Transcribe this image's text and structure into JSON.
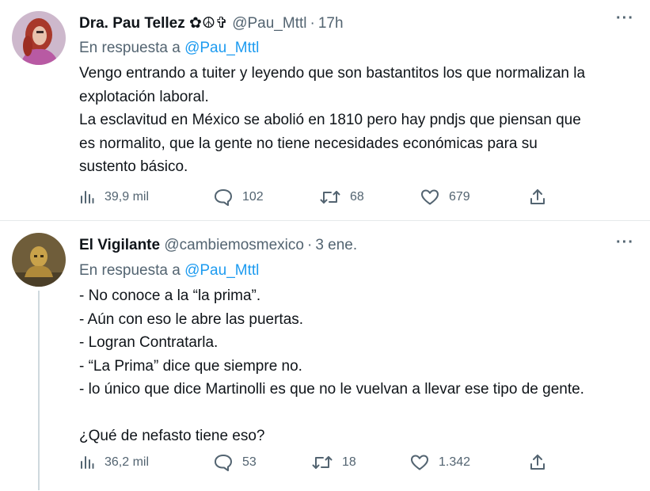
{
  "tweets": [
    {
      "name": "Dra. Pau Tellez",
      "name_symbols": "✿☮✞",
      "handle": "@Pau_Mttl",
      "time": "17h",
      "reply_prefix": "En respuesta a",
      "reply_to": "@Pau_Mttl",
      "lines": [
        "Vengo entrando a tuiter y leyendo que son bastantitos los que normalizan la",
        "explotación laboral.",
        "La esclavitud en México se abolió en 1810 pero hay pndjs que piensan que",
        "es normalito, que la gente no tiene necesidades económicas para su",
        "sustento básico."
      ],
      "stats": {
        "views": "39,9 mil",
        "replies": "102",
        "retweets": "68",
        "likes": "679"
      }
    },
    {
      "name": "El Vigilante",
      "handle": "@cambiemosmexico",
      "time": "3 ene.",
      "reply_prefix": "En respuesta a",
      "reply_to": "@Pau_Mttl",
      "lines": [
        "- No conoce a la “la prima”.",
        "- Aún con eso le abre las puertas.",
        "- Logran Contratarla.",
        "- “La Prima” dice que siempre no.",
        "- lo único que dice Martinolli es que no le vuelvan a llevar ese tipo de gente.",
        "",
        "¿Qué de nefasto tiene eso?"
      ],
      "stats": {
        "views": "36,2 mil",
        "replies": "53",
        "retweets": "18",
        "likes": "1.342"
      }
    }
  ],
  "icons": {
    "views": "bar-chart-icon",
    "reply": "speech-bubble-icon",
    "retweet": "retweet-icon",
    "like": "heart-icon",
    "share": "share-icon",
    "more": "more-icon"
  },
  "colors": {
    "link": "#1d9bf0",
    "muted": "#536471",
    "text": "#0f1419"
  }
}
